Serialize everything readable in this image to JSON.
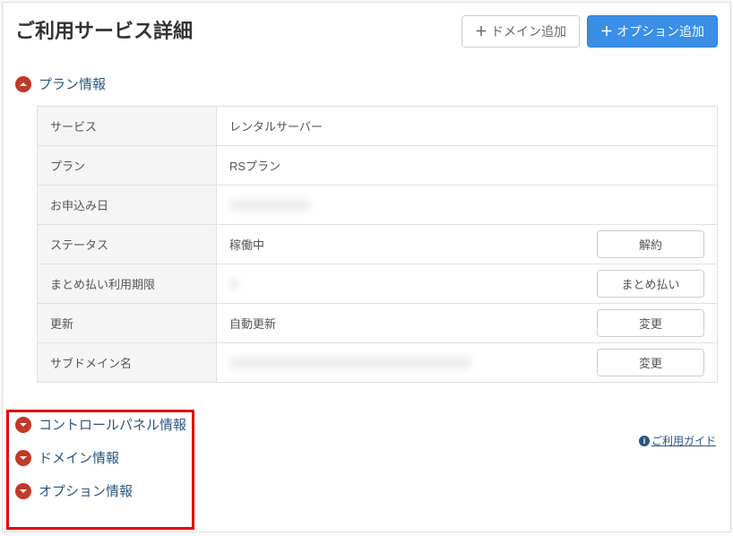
{
  "header": {
    "title": "ご利用サービス詳細",
    "add_domain_label": "ドメイン追加",
    "add_option_label": "オプション追加"
  },
  "sections": {
    "plan": {
      "title": "プラン情報"
    },
    "control_panel": {
      "title": "コントロールパネル情報"
    },
    "domain": {
      "title": "ドメイン情報"
    },
    "option": {
      "title": "オプション情報"
    }
  },
  "plan_table": {
    "rows": [
      {
        "label": "サービス",
        "value": "レンタルサーバー"
      },
      {
        "label": "プラン",
        "value": "RSプラン"
      },
      {
        "label": "お申込み日",
        "value": ""
      },
      {
        "label": "ステータス",
        "value": "稼働中",
        "action": "解約"
      },
      {
        "label": "まとめ払い利用期限",
        "value": "",
        "action": "まとめ払い"
      },
      {
        "label": "更新",
        "value": "自動更新",
        "action": "変更"
      },
      {
        "label": "サブドメイン名",
        "value": "",
        "action": "変更"
      }
    ]
  },
  "help_link": "ご利用ガイド"
}
